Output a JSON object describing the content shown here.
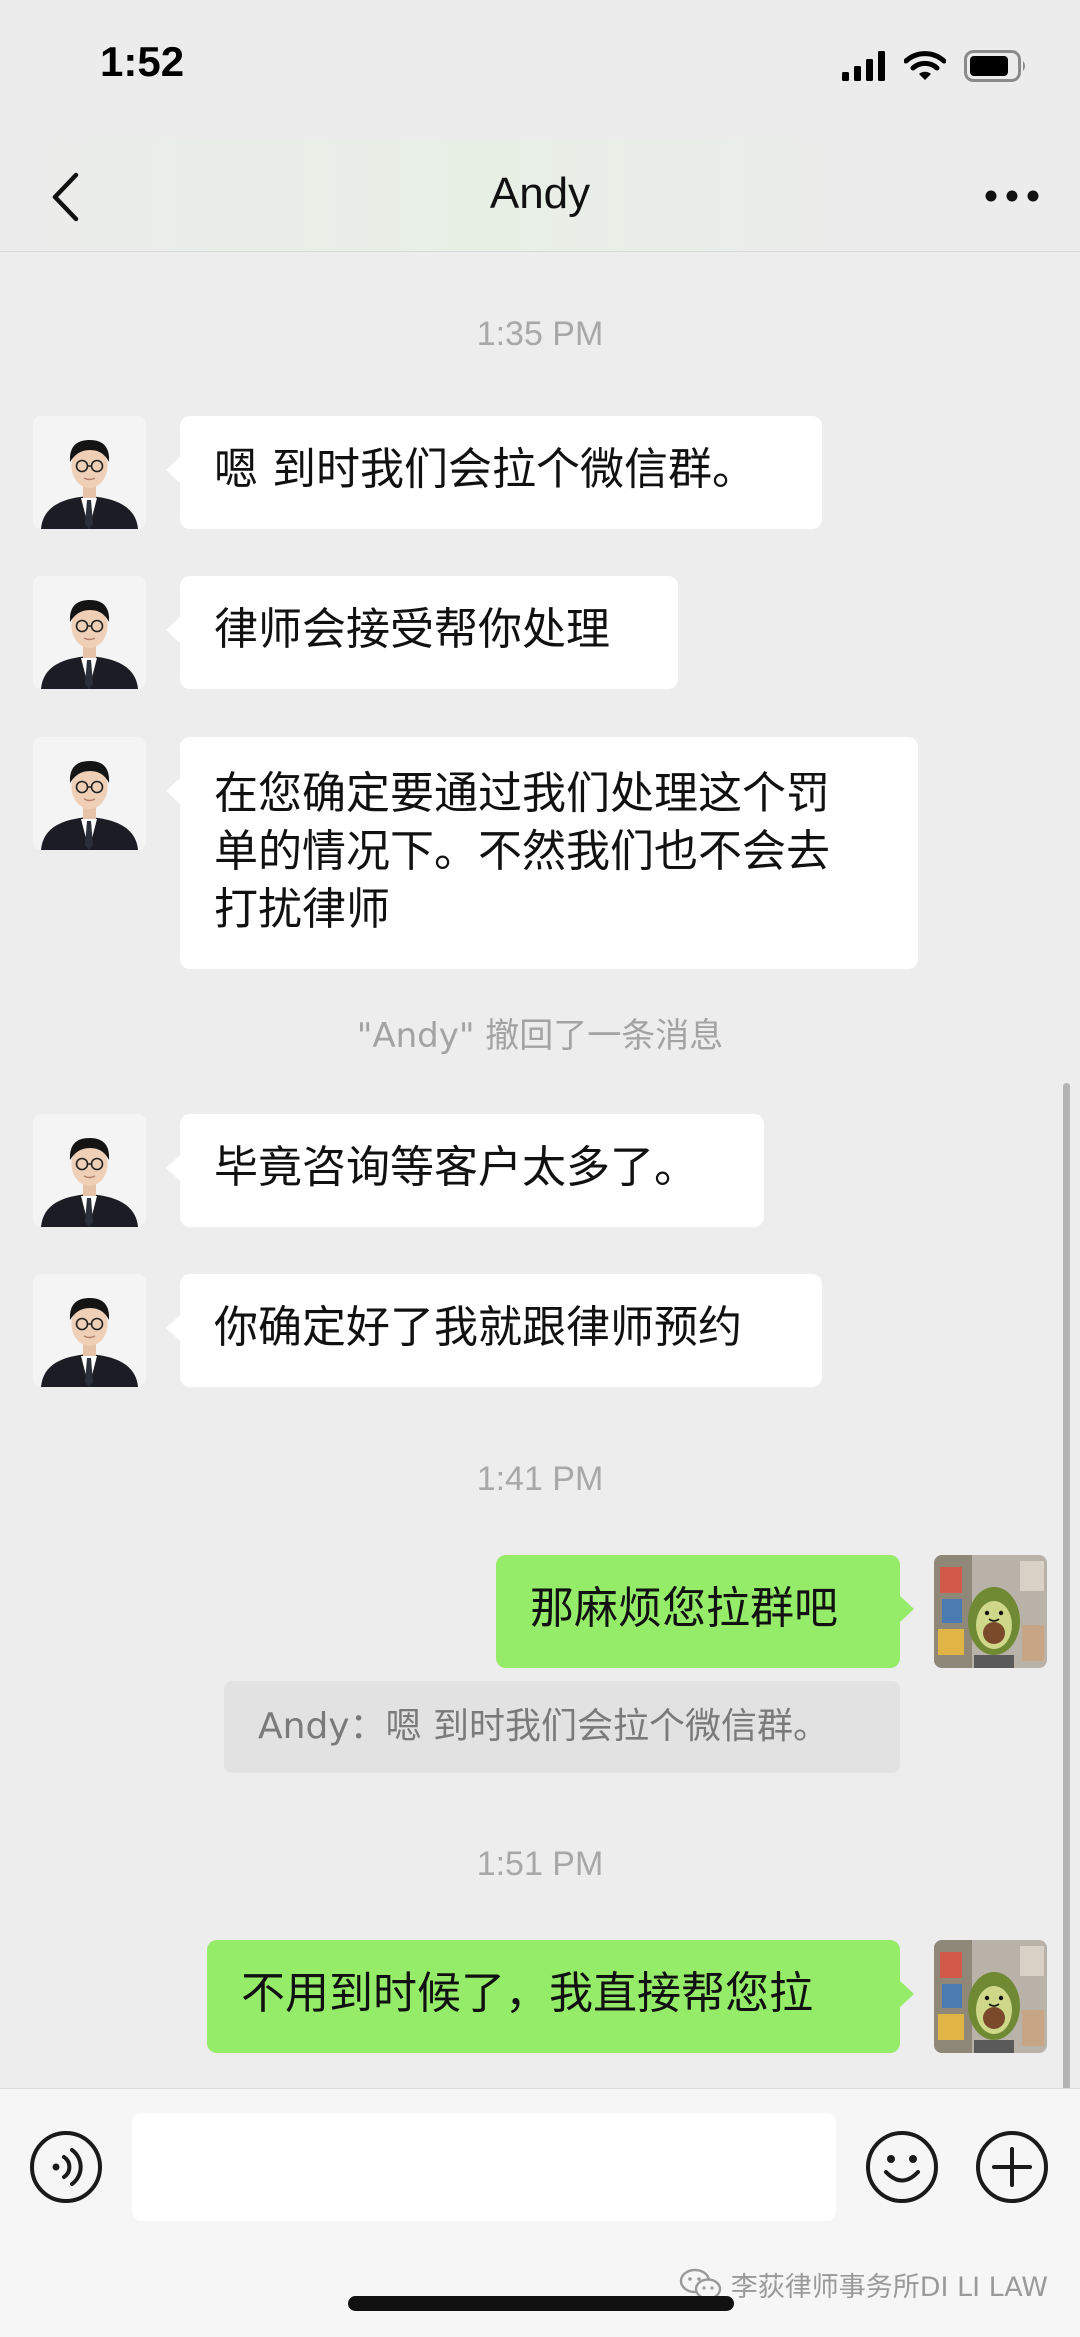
{
  "status_bar": {
    "time": "1:52",
    "icons": [
      "signal-icon",
      "wifi-icon",
      "battery-icon"
    ]
  },
  "nav": {
    "title": "Andy",
    "back_icon": "chevron-left-icon",
    "more_icon": "more-dots-icon"
  },
  "chat": {
    "time_labels": [
      "1:35 PM",
      "1:41 PM",
      "1:51 PM"
    ],
    "incoming": [
      {
        "lines": [
          "嗯 到时我们会拉个微信群。"
        ]
      },
      {
        "lines": [
          "律师会接受帮你处理"
        ]
      },
      {
        "lines": [
          "在您确定要通过我们处理这个罚",
          "单的情况下。不然我们也不会去",
          "打扰律师"
        ]
      },
      {
        "lines": [
          "毕竟咨询等客户太多了。"
        ]
      },
      {
        "lines": [
          "你确定好了我就跟律师预约"
        ]
      }
    ],
    "recall_notice": "\"Andy\" 撤回了一条消息",
    "outgoing": [
      {
        "text": "那麻烦您拉群吧"
      },
      {
        "text": "不用到时候了，我直接帮您拉"
      }
    ],
    "quote": "Andy：嗯 到时我们会拉个微信群。"
  },
  "input_bar": {
    "voice_icon": "voice-icon",
    "emoji_icon": "emoji-icon",
    "add_icon": "plus-circle-icon",
    "input_value": "",
    "input_placeholder": ""
  },
  "watermark": {
    "icon": "wechat-icon",
    "text": "李荻律师事务所DI LI LAW"
  },
  "colors": {
    "background": "#ededed",
    "outgoing_bubble": "#95ec69",
    "incoming_bubble": "#ffffff"
  }
}
